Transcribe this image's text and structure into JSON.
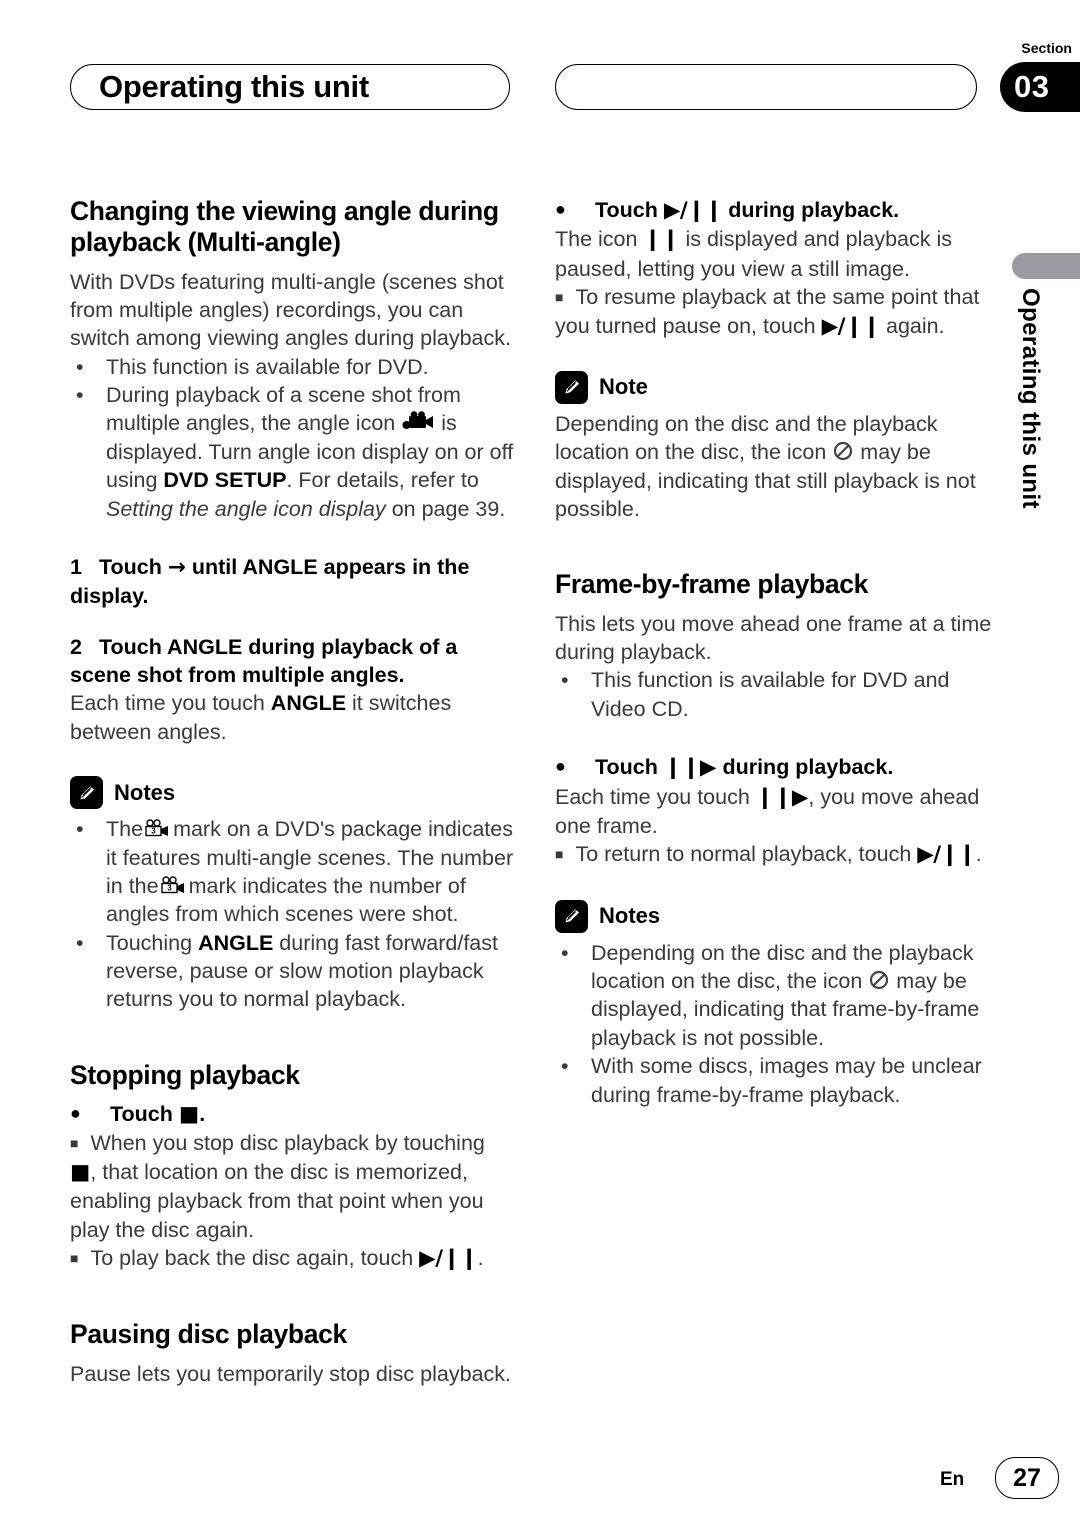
{
  "header": {
    "title": "Operating this unit",
    "section_label": "Section",
    "section_number": "03"
  },
  "side_tab": {
    "text": "Operating this unit"
  },
  "left_column": {
    "heading1": "Changing the viewing angle during playback (Multi-angle)",
    "intro": "With DVDs featuring multi-angle (scenes shot from multiple angles) recordings, you can switch among viewing angles during playback.",
    "bullet1": "This function is available for DVD.",
    "bullet2_part1": "During playback of a scene shot from multiple angles, the angle icon",
    "bullet2_part2": "is displayed. Turn angle icon display on or off using",
    "bullet2_bold": "DVD SETUP",
    "bullet2_part3": ". For details, refer to",
    "bullet2_italic": "Setting the angle icon display",
    "bullet2_part4": "on page 39.",
    "step1_number": "1",
    "step1_pre": "Touch",
    "step1_post": "until ANGLE appears in the display.",
    "step2_number": "2",
    "step2_text": "Touch ANGLE during playback of a scene shot from multiple angles.",
    "step2_body_pre": "Each time you touch",
    "step2_body_bold": "ANGLE",
    "step2_body_post": "it switches between angles.",
    "notes_label": "Notes",
    "note1_pre": "The",
    "note1_mid": "mark on a DVD's package indicates it features multi-angle scenes. The number in the",
    "note1_post": "mark indicates the number of angles from which scenes were shot.",
    "note2_pre": "Touching",
    "note2_bold": "ANGLE",
    "note2_post": "during fast forward/fast reverse, pause or slow motion playback returns you to normal playback.",
    "heading2": "Stopping playback",
    "stop_touch_pre": "Touch",
    "stop_touch_post": ".",
    "stop_sub1_pre": "When you stop disc playback by touching",
    "stop_sub1_post": ", that location on the disc is memorized, enabling playback from that point when you play the disc again.",
    "stop_sub2_pre": "To play back the disc again, touch",
    "stop_sub2_post": ".",
    "heading3": "Pausing disc playback",
    "pause_body": "Pause lets you temporarily stop disc playback."
  },
  "right_column": {
    "pause_touch_pre": "Touch",
    "pause_touch_post": "during playback.",
    "pause_body_pre": "The icon",
    "pause_body_post": "is displayed and playback is paused, letting you view a still image.",
    "pause_sub_pre": "To resume playback at the same point that you turned pause on, touch",
    "pause_sub_post": "again.",
    "note_label": "Note",
    "note_pre": "Depending on the disc and the playback location on the disc, the icon",
    "note_post": "may be displayed, indicating that still playback is not possible.",
    "heading1": "Frame-by-frame playback",
    "intro": "This lets you move ahead one frame at a time during playback.",
    "bullet1": "This function is available for DVD and Video CD.",
    "fbf_touch_pre": "Touch",
    "fbf_touch_post": "during playback.",
    "fbf_body_pre": "Each time you touch",
    "fbf_body_post": ", you move ahead one frame.",
    "fbf_sub_pre": "To return to normal playback, touch",
    "fbf_sub_post": ".",
    "notes_label": "Notes",
    "note1_pre": "Depending on the disc and the playback location on the disc, the icon",
    "note1_post": "may be displayed, indicating that frame-by-frame playback is not possible.",
    "note2": "With some discs, images may be unclear during frame-by-frame playback."
  },
  "footer": {
    "language": "En",
    "page_number": "27"
  },
  "icons": {
    "note_pencil": "pencil-icon",
    "angle_camera_filled": "movie-camera-filled-icon",
    "angle_camera_mark": "movie-camera-3-mark-icon",
    "prohibited": "prohibited-icon",
    "play_pause": "play-pause-icon",
    "pause": "pause-icon",
    "stop": "stop-icon",
    "frame_advance": "frame-advance-icon",
    "arrow_right": "arrow-right-icon"
  },
  "colors": {
    "accent_gray": "#9a9aa2",
    "ink": "#231f20",
    "body": "#3a3a3a"
  }
}
